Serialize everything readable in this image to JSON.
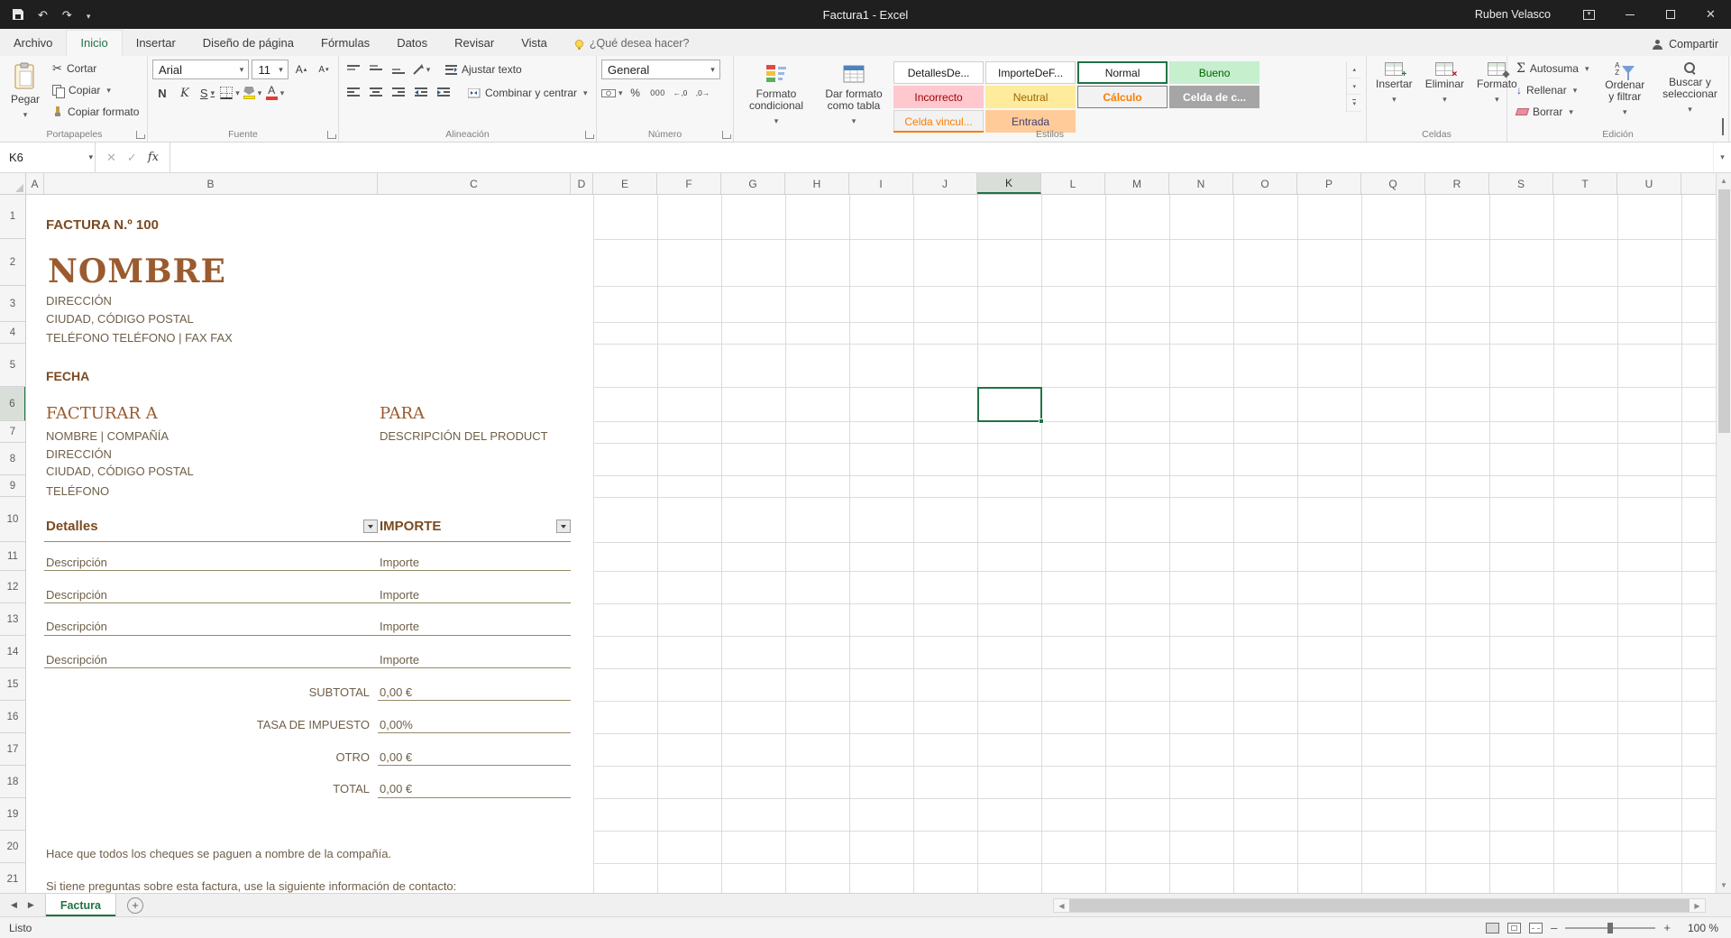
{
  "titlebar": {
    "title": "Factura1 - Excel",
    "user": "Ruben Velasco"
  },
  "menu": {
    "file": "Archivo",
    "tabs": [
      "Inicio",
      "Insertar",
      "Diseño de página",
      "Fórmulas",
      "Datos",
      "Revisar",
      "Vista"
    ],
    "active_tab": "Inicio",
    "search_placeholder": "¿Qué desea hacer?",
    "share": "Compartir"
  },
  "ribbon": {
    "clipboard": {
      "group": "Portapapeles",
      "paste": "Pegar",
      "cut": "Cortar",
      "copy": "Copiar",
      "painter": "Copiar formato"
    },
    "font": {
      "group": "Fuente",
      "name": "Arial",
      "size": "11",
      "bold": "N",
      "italic": "K",
      "underline": "S"
    },
    "alignment": {
      "group": "Alineación",
      "wrap": "Ajustar texto",
      "merge": "Combinar y centrar"
    },
    "number": {
      "group": "Número",
      "format": "General",
      "percent": "%",
      "thousands": "000",
      "inc_dec": "←,0",
      "dec_dec": ",0→"
    },
    "styles": {
      "group": "Estilos",
      "conditional": "Formato condicional",
      "as_table": "Dar formato como tabla",
      "chips": [
        {
          "label": "DetallesDe...",
          "bg": "#ffffff",
          "fg": "#1a1a1a",
          "border": "#cfcfcf"
        },
        {
          "label": "ImporteDeF...",
          "bg": "#ffffff",
          "fg": "#1a1a1a",
          "border": "#cfcfcf"
        },
        {
          "label": "Normal",
          "bg": "#ffffff",
          "fg": "#1a1a1a",
          "border": "#217346",
          "selected": true
        },
        {
          "label": "Bueno",
          "bg": "#c6efce",
          "fg": "#006100"
        },
        {
          "label": "Incorrecto",
          "bg": "#ffc7ce",
          "fg": "#9c0006"
        },
        {
          "label": "Neutral",
          "bg": "#ffeb9c",
          "fg": "#9c6500"
        },
        {
          "label": "Cálculo",
          "bg": "#f2f2f2",
          "fg": "#fa7d00",
          "border": "#7f7f7f",
          "bold": true
        },
        {
          "label": "Celda de c...",
          "bg": "#a5a5a5",
          "fg": "#ffffff",
          "bold": true
        },
        {
          "label": "Celda vincul...",
          "bg": "#f2f2f2",
          "fg": "#fa7d00",
          "border_bottom": "#fa7d00"
        },
        {
          "label": "Entrada",
          "bg": "#ffcc99",
          "fg": "#3f3f76"
        }
      ]
    },
    "cells": {
      "group": "Celdas",
      "insert": "Insertar",
      "del": "Eliminar",
      "format": "Formato"
    },
    "editing": {
      "group": "Edición",
      "autosum": "Autosuma",
      "sigma": "Σ",
      "fill": "Rellenar",
      "clear": "Borrar",
      "sort": "Ordenar y filtrar",
      "find": "Buscar y seleccionar"
    }
  },
  "formula_bar": {
    "name_box": "K6",
    "fx": "fx",
    "value": ""
  },
  "grid": {
    "columns": [
      "A",
      "B",
      "C",
      "D",
      "E",
      "F",
      "G",
      "H",
      "I",
      "J",
      "K",
      "L",
      "M",
      "N",
      "O",
      "P",
      "Q",
      "R",
      "S",
      "T",
      "U"
    ],
    "rows": [
      "1",
      "2",
      "3",
      "4",
      "5",
      "6",
      "7",
      "8",
      "9",
      "10",
      "11",
      "12",
      "13",
      "14",
      "15",
      "16",
      "17",
      "18",
      "19",
      "20",
      "21"
    ],
    "selected_col": "K",
    "selected_row": "6",
    "selected_cell": "K6"
  },
  "invoice": {
    "number": "FACTURA N.º 100",
    "name": "NOMBRE",
    "address1": "DIRECCIÓN",
    "address2": "CIUDAD, CÓDIGO POSTAL",
    "phone": "TELÉFONO TELÉFONO | FAX FAX",
    "date_label": "FECHA",
    "bill_to": "FACTURAR A",
    "for_label": "PARA",
    "client_name": "NOMBRE | COMPAÑÍA",
    "product": "DESCRIPCIÓN DEL PRODUCT",
    "client_address1": "DIRECCIÓN",
    "client_address2": "CIUDAD, CÓDIGO POSTAL",
    "client_phone": "TELÉFONO",
    "details_header": "Detalles",
    "amount_header": "IMPORTE",
    "items": [
      {
        "desc": "Descripción",
        "amount": "Importe"
      },
      {
        "desc": "Descripción",
        "amount": "Importe"
      },
      {
        "desc": "Descripción",
        "amount": "Importe"
      },
      {
        "desc": "Descripción",
        "amount": "Importe"
      }
    ],
    "subtotal_label": "SUBTOTAL",
    "subtotal_value": "0,00 €",
    "tax_label": "TASA DE IMPUESTO",
    "tax_value": "0,00%",
    "other_label": "OTRO",
    "other_value": "0,00 €",
    "total_label": "TOTAL",
    "total_value": "0,00 €",
    "note1": "Hace que todos los cheques se paguen a nombre de la compañía.",
    "note2": "Si tiene preguntas sobre esta factura, use la siguiente información de contacto:"
  },
  "sheet_tabs": {
    "active": "Factura"
  },
  "status": {
    "mode": "Listo",
    "zoom": "100 %"
  },
  "colors": {
    "accent": "#217346",
    "heading": "#7b4a21",
    "serif_heading": "#9a5b2e",
    "body_text": "#6e5f48",
    "rule": "#968a66"
  }
}
